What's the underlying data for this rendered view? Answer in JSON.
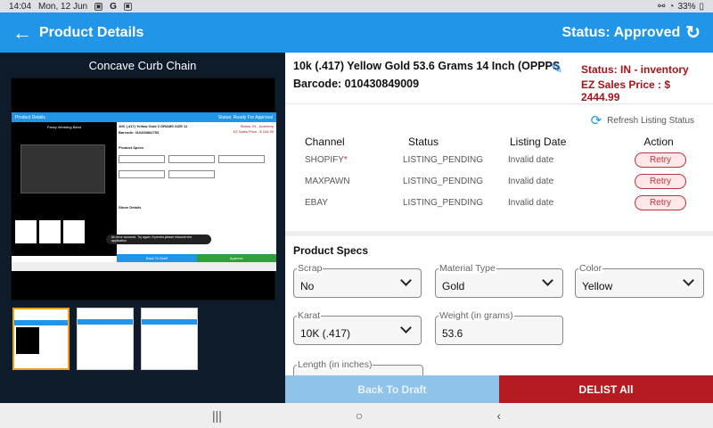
{
  "statusbar": {
    "time": "14:04",
    "date": "Mon, 12 Jun",
    "battery": "33%"
  },
  "appbar": {
    "title": "Product Details",
    "status": "Status: Approved"
  },
  "left": {
    "image_title": "Concave Curb Chain",
    "mini": {
      "bar_title": "Product Details",
      "bar_status": "Status: Ready For Approval",
      "image_title": "Fancy Wedding Band",
      "name": "10K (.417) Yellow Gold 2 GRAMS SIZE 11",
      "barcode": "Barcode: 010430862753",
      "inv": "Status: IN - inventory",
      "price": "EZ Sales Price : $ 154.99",
      "specs": "Product Specs",
      "stones": "Stone Details",
      "error": "An error occurred. Try again. If persist please relaunch the application",
      "btn_draft": "Back To Draft",
      "btn_approve": "Approve"
    },
    "thumbs": [
      {
        "selected": true
      },
      {
        "selected": false
      },
      {
        "selected": false
      }
    ]
  },
  "product": {
    "name": "10k (.417) Yellow Gold 53.6 Grams 14 Inch (OPPPSS...",
    "barcode": "Barcode: 010430849009",
    "inventory_status": "Status: IN - inventory",
    "price": "EZ Sales Price : $ 2444.99"
  },
  "listing": {
    "refresh_label": "Refresh Listing Status",
    "headers": {
      "channel": "Channel",
      "status": "Status",
      "date": "Listing Date",
      "action": "Action"
    },
    "rows": [
      {
        "channel": "SHOPIFY",
        "required": "*",
        "status": "LISTING_PENDING",
        "date": "Invalid date",
        "action": "Retry"
      },
      {
        "channel": "MAXPAWN",
        "status": "LISTING_PENDING",
        "date": "Invalid date",
        "action": "Retry"
      },
      {
        "channel": "EBAY",
        "status": "LISTING_PENDING",
        "date": "Invalid date",
        "action": "Retry"
      }
    ]
  },
  "specs": {
    "title": "Product Specs",
    "scrap": {
      "label": "Scrap",
      "value": "No"
    },
    "material": {
      "label": "Material Type",
      "value": "Gold"
    },
    "color": {
      "label": "Color",
      "value": "Yellow"
    },
    "karat": {
      "label": "Karat",
      "value": "10K (.417)"
    },
    "weight": {
      "label": "Weight (in grams)",
      "value": "53.6"
    },
    "length": {
      "label": "Length (in inches)",
      "value": ""
    }
  },
  "actions": {
    "back_to_draft": "Back To Draft",
    "delist_all": "DELIST All"
  },
  "colors": {
    "primary": "#2196e8",
    "danger": "#b51c22",
    "accent_text": "#a3141b"
  }
}
